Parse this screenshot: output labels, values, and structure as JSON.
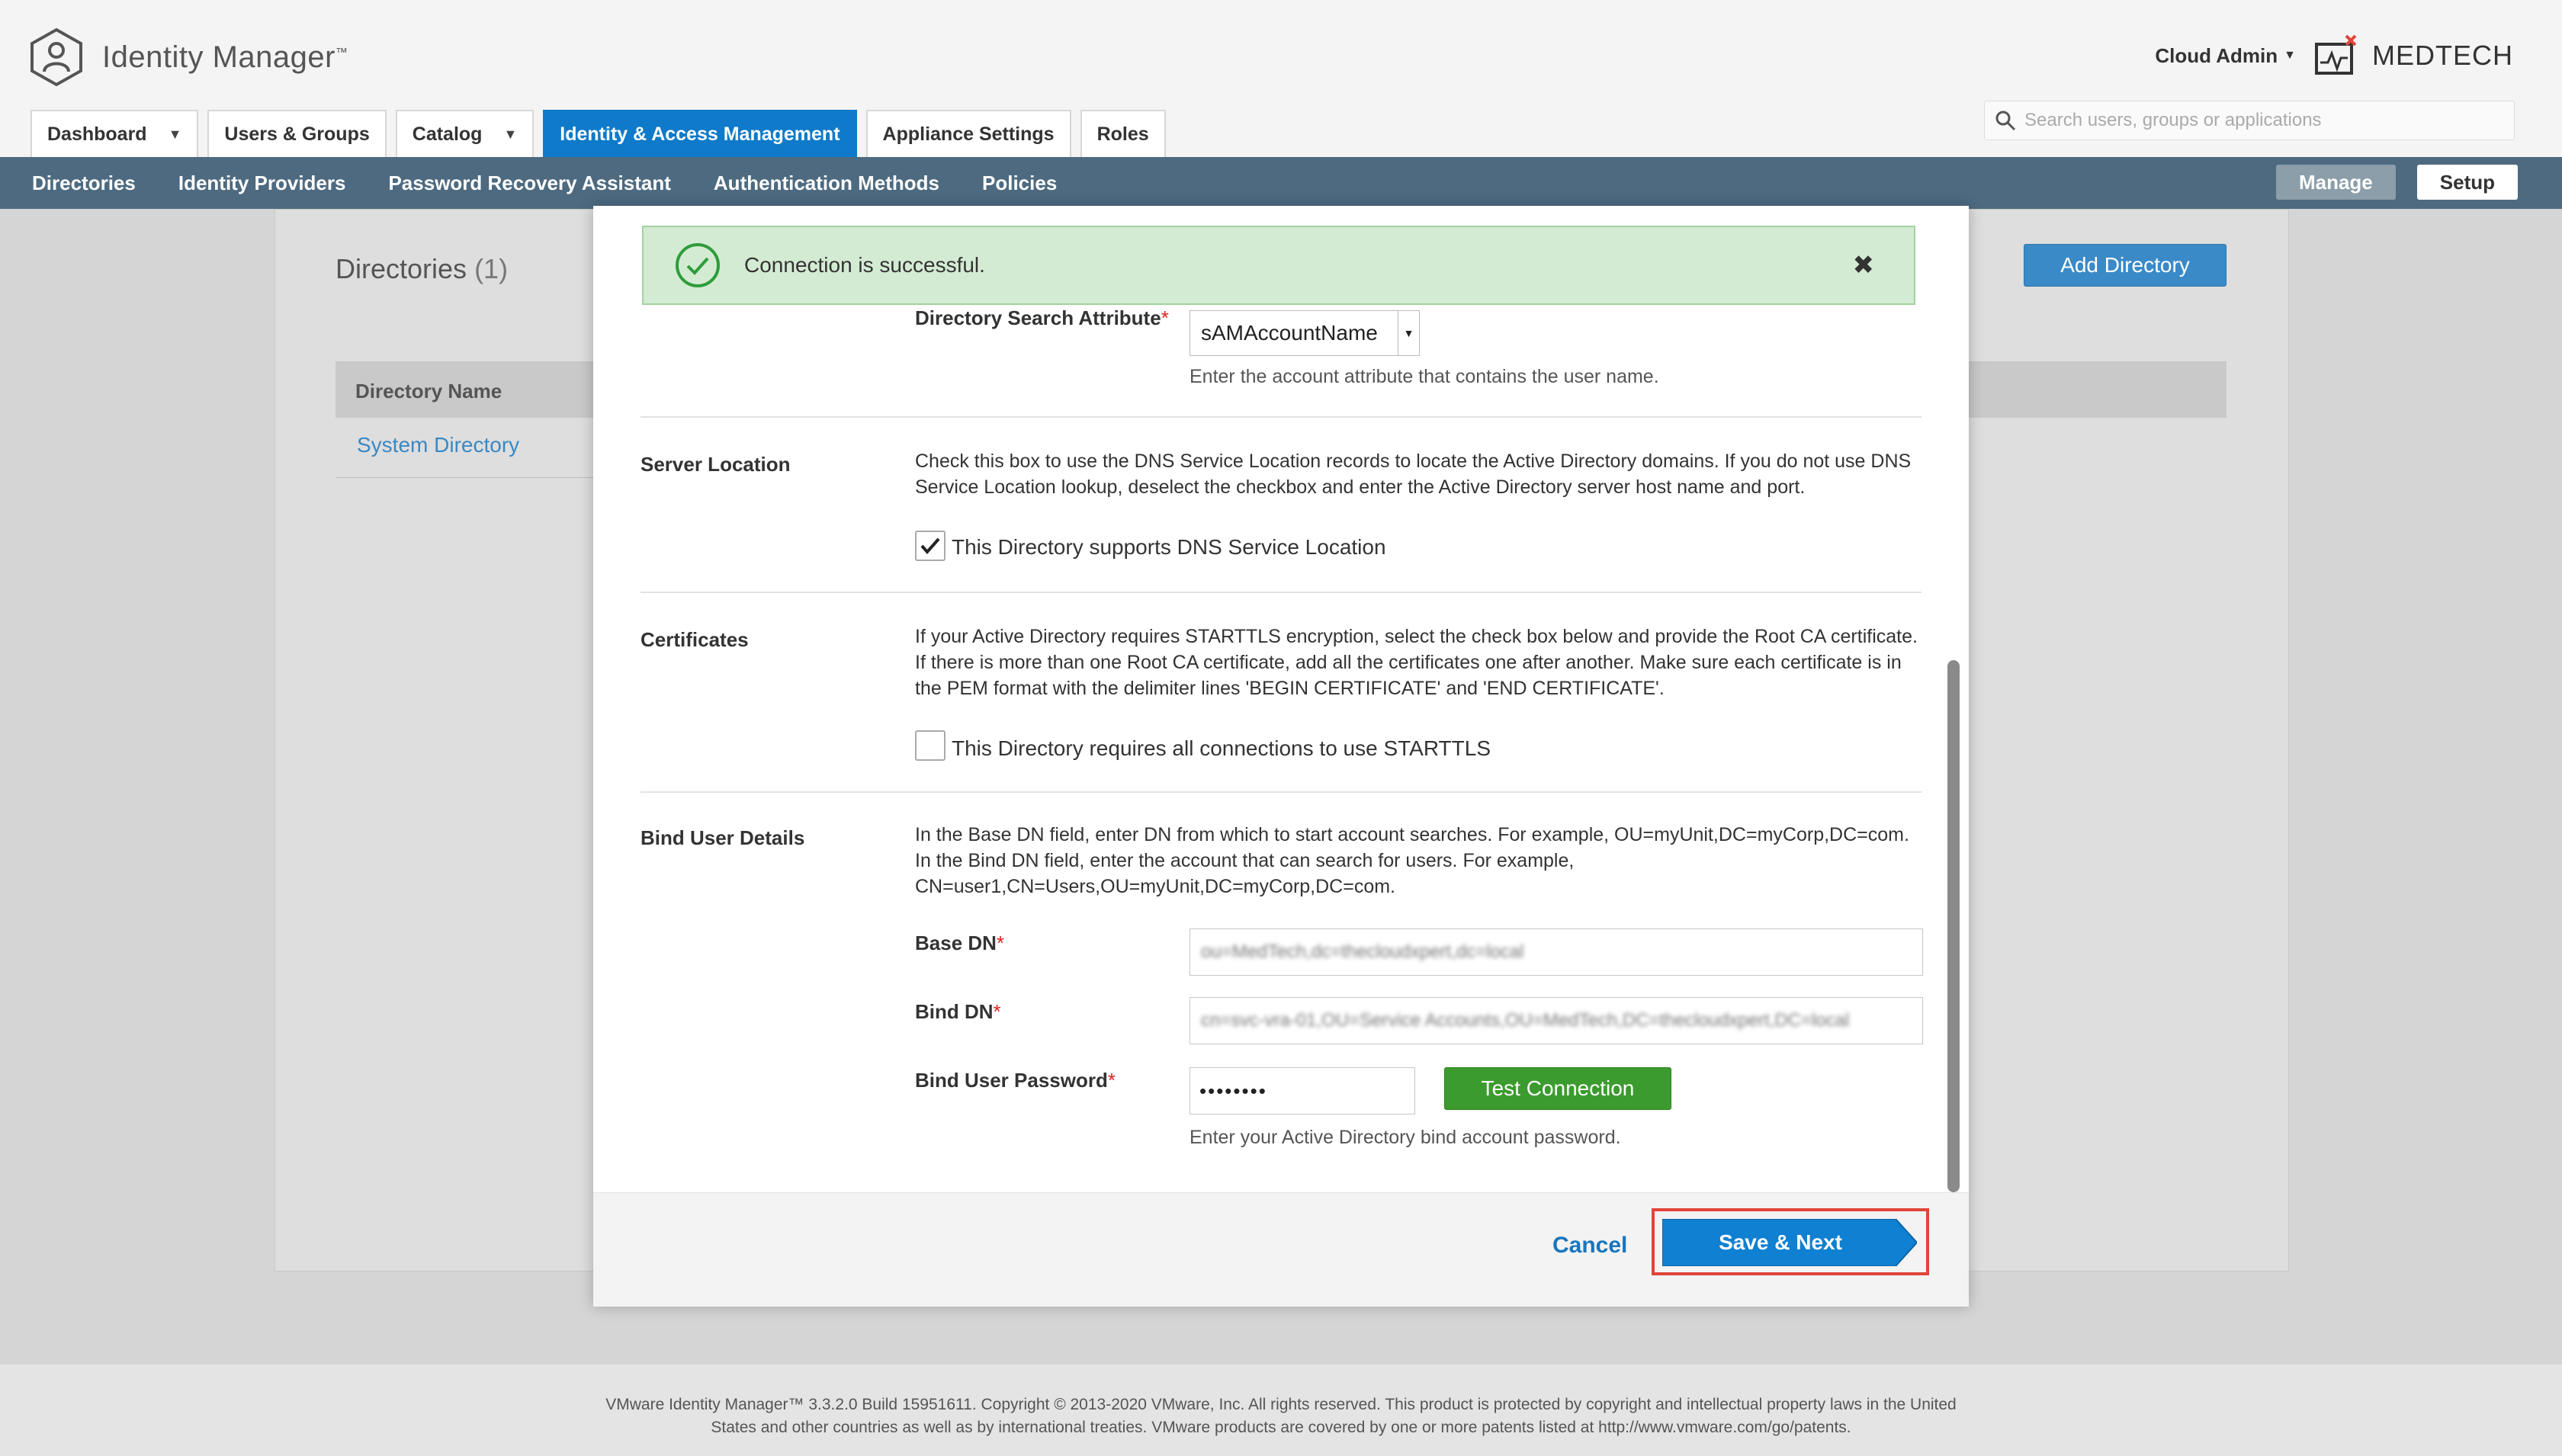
{
  "app": {
    "logo_text": "Identity Manager",
    "logo_tm": "™",
    "user_menu": "Cloud Admin",
    "brand": "MEDTECH",
    "search_placeholder": "Search users, groups or applications"
  },
  "tabs": [
    {
      "label": "Dashboard",
      "dropdown": true
    },
    {
      "label": "Users & Groups",
      "dropdown": false
    },
    {
      "label": "Catalog",
      "dropdown": true
    },
    {
      "label": "Identity & Access Management",
      "dropdown": false,
      "active": true
    },
    {
      "label": "Appliance Settings",
      "dropdown": false
    },
    {
      "label": "Roles",
      "dropdown": false
    }
  ],
  "subnav": {
    "items": [
      "Directories",
      "Identity Providers",
      "Password Recovery Assistant",
      "Authentication Methods",
      "Policies"
    ],
    "manage": "Manage",
    "setup": "Setup"
  },
  "page": {
    "title": "Directories",
    "count": "(1)",
    "add_button": "Add Directory",
    "table_header": "Directory Name",
    "rows": [
      "System Directory"
    ]
  },
  "alert": {
    "message": "Connection is successful.",
    "close": "✖"
  },
  "form": {
    "search_attr_label": "Directory Search Attribute",
    "search_attr_value": "sAMAccountName",
    "search_attr_hint": "Enter the account attribute that contains the user name.",
    "server_location": {
      "label": "Server Location",
      "desc": "Check this box to use the DNS Service Location records to locate the Active Directory domains. If you do not use DNS Service Location lookup, deselect the checkbox and enter the Active Directory server host name and port.",
      "checkbox_label": "This Directory supports DNS Service Location",
      "checked": true
    },
    "certificates": {
      "label": "Certificates",
      "desc": "If your Active Directory requires STARTTLS encryption, select the check box below and provide the Root CA certificate. If there is more than one Root CA certificate, add all the certificates one after another. Make sure each certificate is in the PEM format with the delimiter lines 'BEGIN CERTIFICATE' and 'END CERTIFICATE'.",
      "checkbox_label": "This Directory requires all connections to use STARTTLS",
      "checked": false
    },
    "bind_user": {
      "label": "Bind User Details",
      "desc": "In the Base DN field, enter DN from which to start account searches. For example, OU=myUnit,DC=myCorp,DC=com. In the Bind DN field, enter the account that can search for users. For example, CN=user1,CN=Users,OU=myUnit,DC=myCorp,DC=com.",
      "base_dn_label": "Base DN",
      "base_dn_value": "ou=MedTech,dc=thecloudxpert,dc=local",
      "bind_dn_label": "Bind DN",
      "bind_dn_value": "cn=svc-vra-01,OU=Service Accounts,OU=MedTech,DC=thecloudxpert,DC=local",
      "password_label": "Bind User Password",
      "password_value": "••••••••",
      "test_button": "Test Connection",
      "password_hint": "Enter your Active Directory bind account password.",
      "required_mark": "*"
    }
  },
  "footer_actions": {
    "cancel": "Cancel",
    "save": "Save & Next"
  },
  "footer": {
    "line1": "VMware Identity Manager™ 3.3.2.0 Build 15951611. Copyright © 2013-2020 VMware, Inc. All rights reserved. This product is protected by copyright and intellectual property laws in the United",
    "line2": "States and other countries as well as by international treaties. VMware products are covered by one or more patents listed at http://www.vmware.com/go/patents."
  },
  "colors": {
    "accent": "#0e7ac9",
    "subnav": "#4d6a80",
    "success_bg": "#d4ebd3",
    "test_button": "#3c9b2e",
    "highlight": "#e0453a"
  }
}
